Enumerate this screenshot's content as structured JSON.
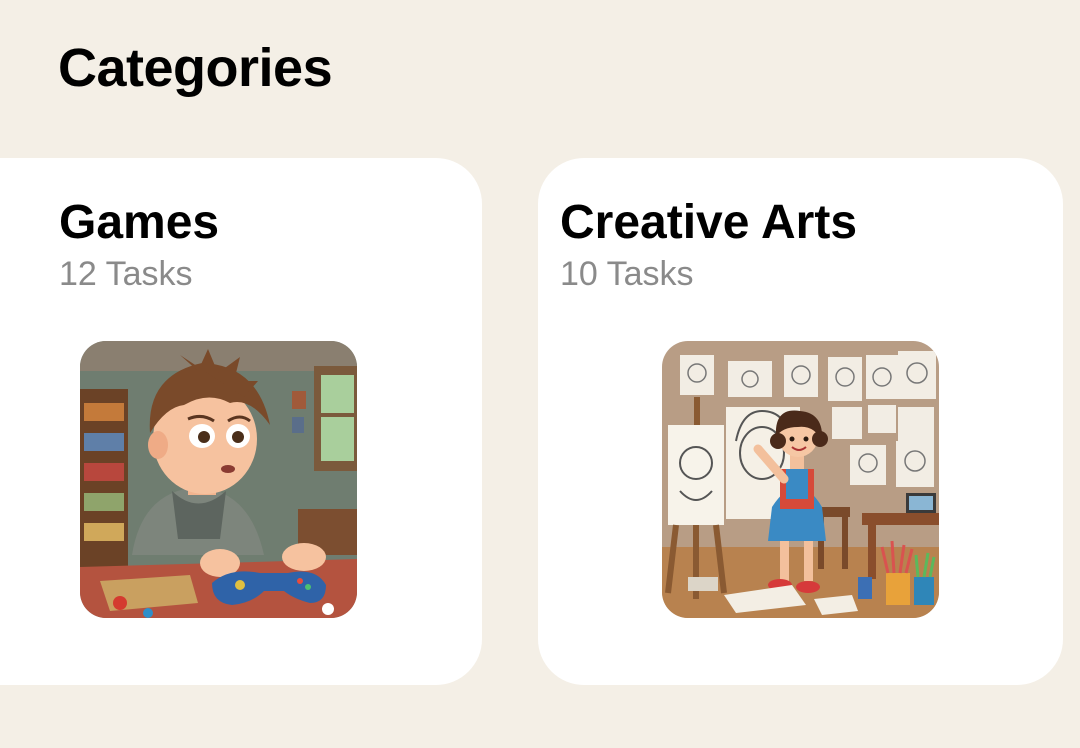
{
  "page": {
    "title": "Categories"
  },
  "categories": [
    {
      "title": "Games",
      "subtitle": "12 Tasks",
      "image": "boy-playing-video-game-illustration"
    },
    {
      "title": "Creative Arts",
      "subtitle": "10 Tasks",
      "image": "girl-drawing-portraits-illustration"
    }
  ]
}
